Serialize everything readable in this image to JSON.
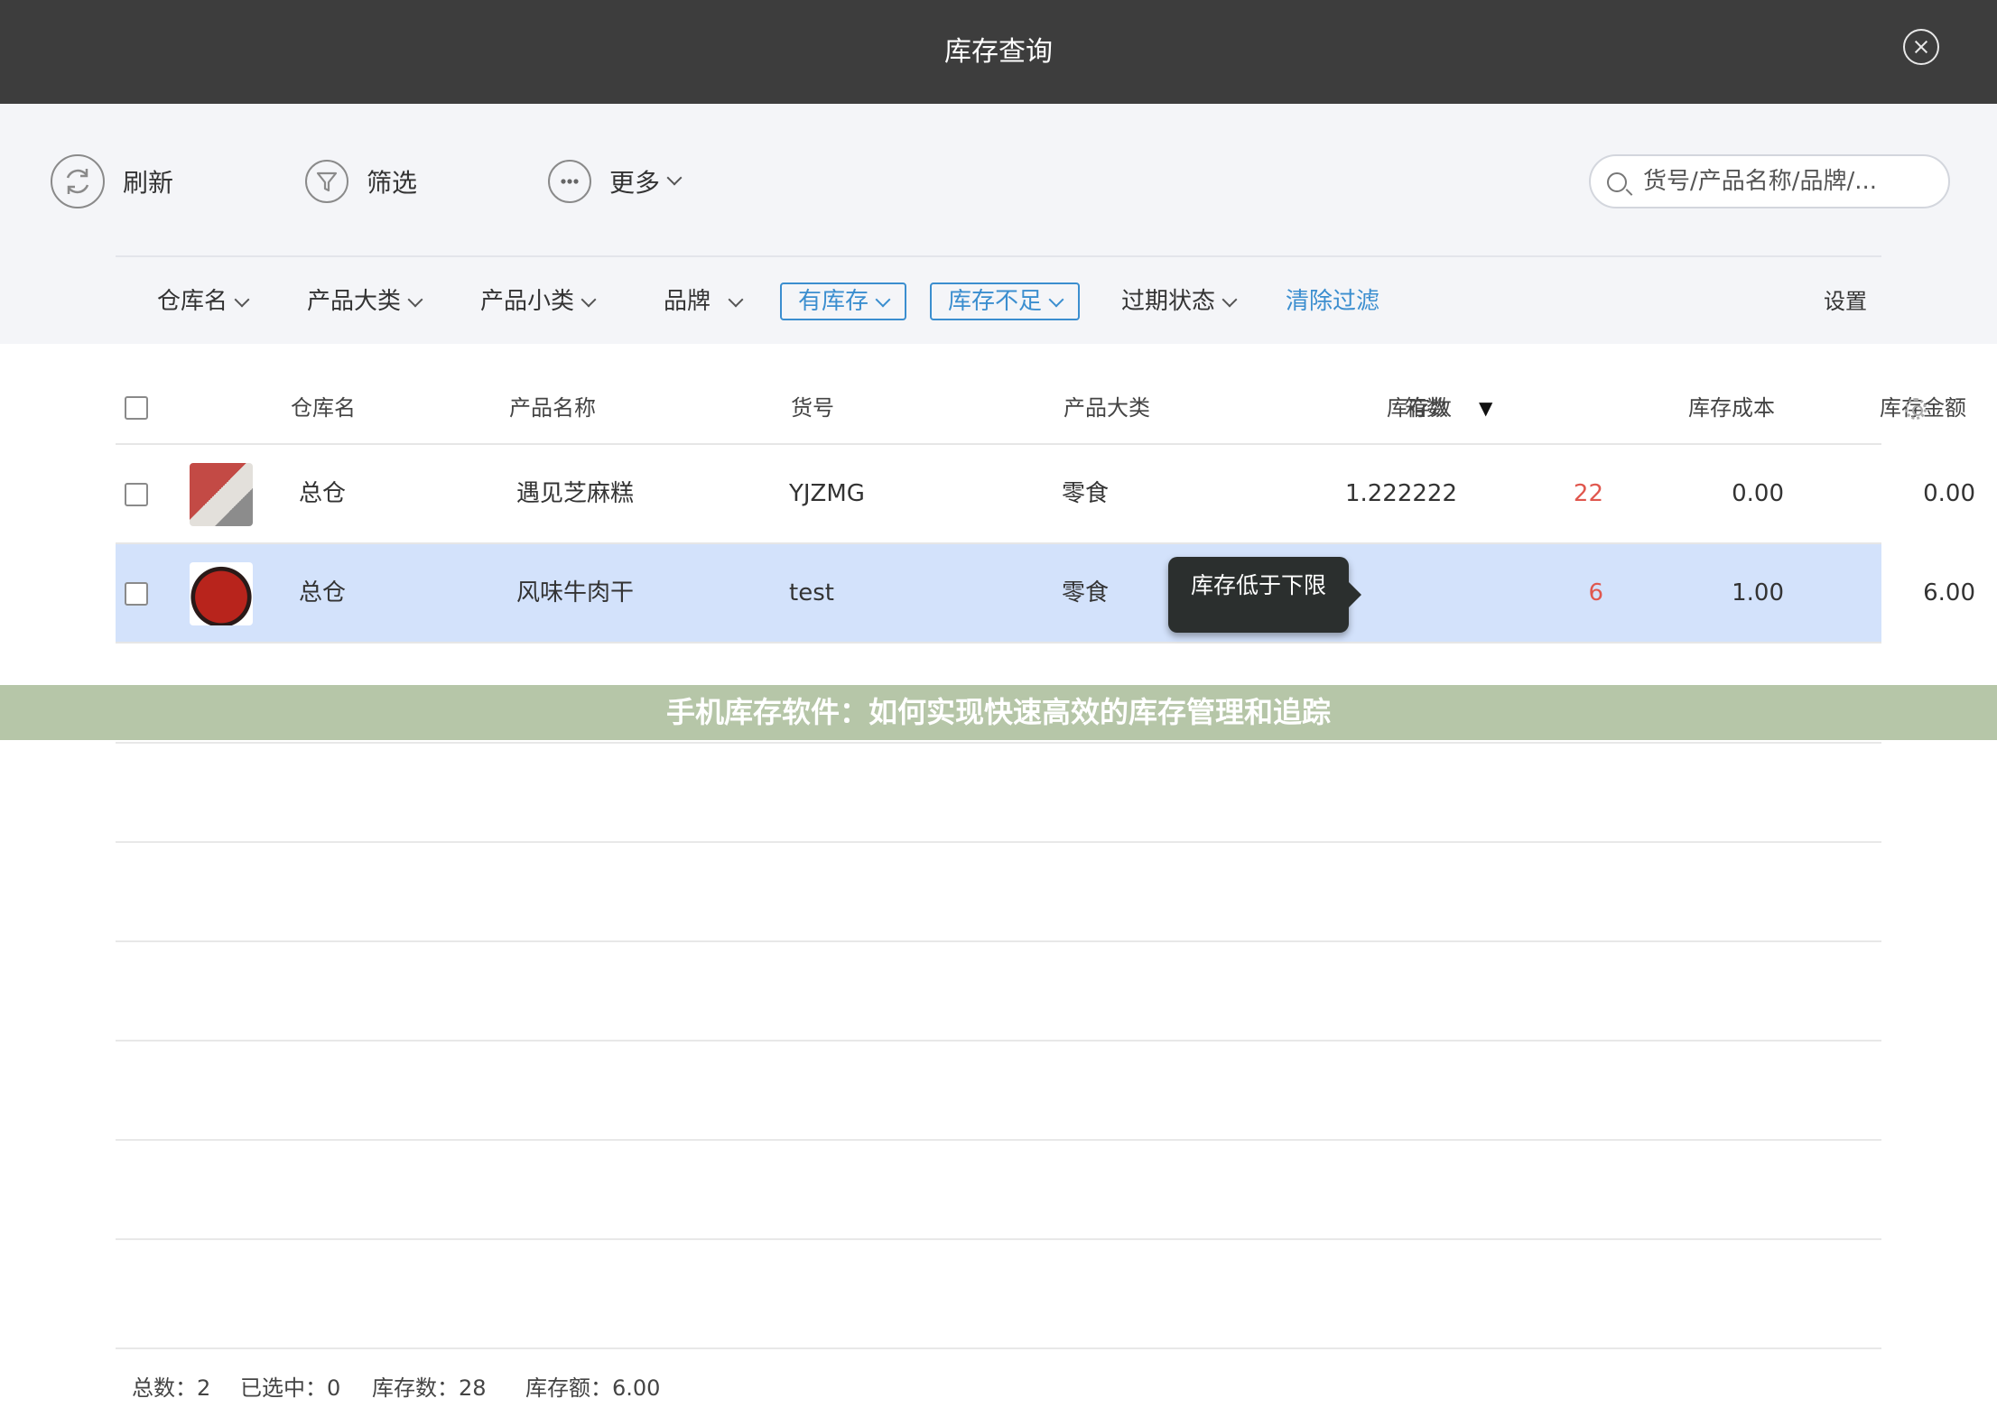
{
  "window": {
    "title": "库存查询"
  },
  "toolbar": {
    "refresh_label": "刷新",
    "filter_label": "筛选",
    "more_label": "更多",
    "search_placeholder": "货号/产品名称/品牌/..."
  },
  "filters": {
    "warehouse": "仓库名",
    "category": "产品大类",
    "subcategory": "产品小类",
    "brand": "品牌",
    "in_stock": "有库存",
    "low_stock": "库存不足",
    "expiry": "过期状态",
    "clear": "清除过滤",
    "settings": "设置"
  },
  "table": {
    "headers": {
      "warehouse": "仓库名",
      "product_name": "产品名称",
      "sku": "货号",
      "category": "产品大类",
      "boxes": "箱数",
      "stock": "库存数",
      "cost": "库存成本",
      "amount": "库存金额"
    },
    "rows": [
      {
        "warehouse": "总仓",
        "product_name": "遇见芝麻糕",
        "sku": "YJZMG",
        "category": "零食",
        "boxes": "1.222222",
        "stock": "22",
        "cost": "0.00",
        "amount": "0.00",
        "selected": false
      },
      {
        "warehouse": "总仓",
        "product_name": "风味牛肉干",
        "sku": "test",
        "category": "零食",
        "boxes": "",
        "stock": "6",
        "cost": "1.00",
        "amount": "6.00",
        "selected": true
      }
    ]
  },
  "tooltip": {
    "text": "库存低于下限"
  },
  "banner": {
    "text": "手机库存软件：如何实现快速高效的库存管理和追踪"
  },
  "footer": {
    "total": "总数：2",
    "selected": "已选中：0",
    "stock_total": "库存数：28",
    "amount_total": "库存额：6.00"
  },
  "colors": {
    "titlebar": "#3d3d3d",
    "accent": "#3b8ecf",
    "warning": "#e0574e",
    "selected_row": "#d3e2fb",
    "banner": "#b6c6a8"
  }
}
